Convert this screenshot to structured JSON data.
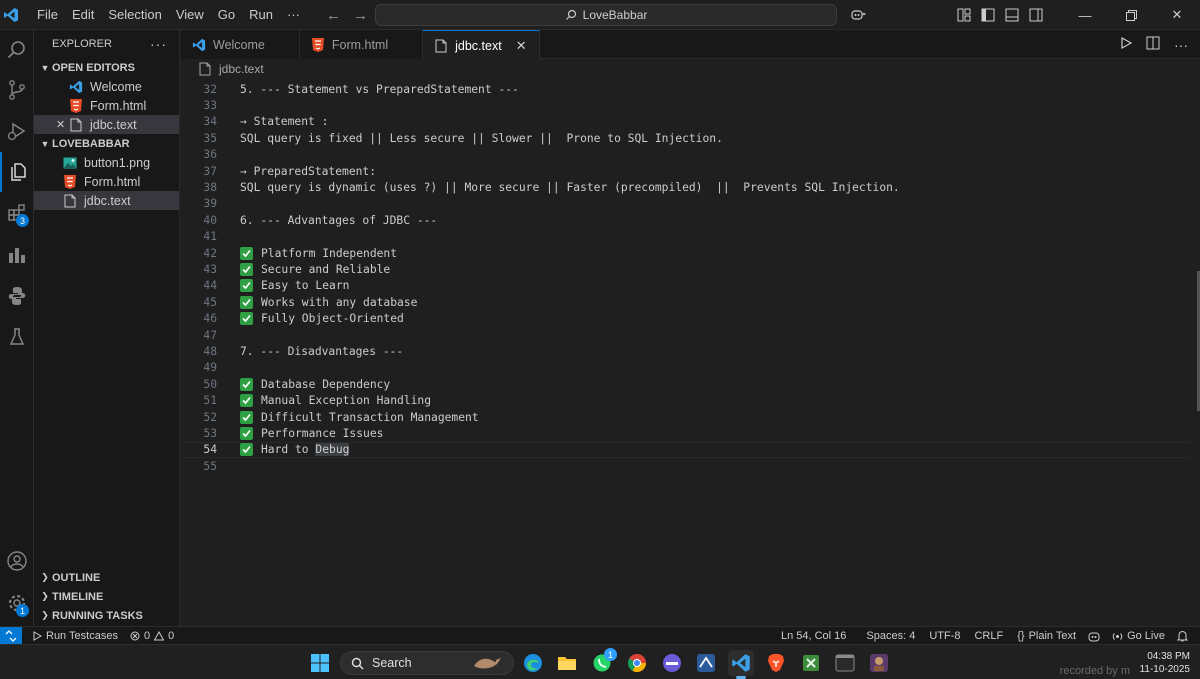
{
  "titlebar": {
    "menu": [
      "File",
      "Edit",
      "Selection",
      "View",
      "Go",
      "Run",
      "···"
    ],
    "search_text": "LoveBabbar"
  },
  "activity_bar": {
    "extensions_badge": "3",
    "settings_badge": "1"
  },
  "sidebar": {
    "title": "EXPLORER",
    "open_editors_label": "OPEN EDITORS",
    "open_editors": [
      {
        "name": "Welcome",
        "icon": "vscode-icon"
      },
      {
        "name": "Form.html",
        "icon": "html-icon"
      },
      {
        "name": "jdbc.text",
        "icon": "file-icon"
      }
    ],
    "folder_label": "LOVEBABBAR",
    "files": [
      {
        "name": "button1.png",
        "icon": "image-icon"
      },
      {
        "name": "Form.html",
        "icon": "html-icon"
      },
      {
        "name": "jdbc.text",
        "icon": "file-icon"
      }
    ],
    "outline_label": "OUTLINE",
    "timeline_label": "TIMELINE",
    "running_tasks_label": "RUNNING TASKS"
  },
  "tabs": [
    {
      "label": "Welcome",
      "icon": "vscode-icon"
    },
    {
      "label": "Form.html",
      "icon": "html-icon"
    },
    {
      "label": "jdbc.text",
      "icon": "file-icon"
    }
  ],
  "breadcrumb": "jdbc.text",
  "editor": {
    "lines": [
      {
        "n": "32",
        "text": "5. --- Statement vs PreparedStatement ---"
      },
      {
        "n": "33",
        "text": ""
      },
      {
        "n": "34",
        "text": "→ Statement :"
      },
      {
        "n": "35",
        "text": "SQL query is fixed || Less secure || Slower ||  Prone to SQL Injection."
      },
      {
        "n": "36",
        "text": ""
      },
      {
        "n": "37",
        "text": "→ PreparedStatement:"
      },
      {
        "n": "38",
        "text": "SQL query is dynamic (uses ?) || More secure || Faster (precompiled)  ||  Prevents SQL Injection."
      },
      {
        "n": "39",
        "text": ""
      },
      {
        "n": "40",
        "text": "6. --- Advantages of JDBC ---"
      },
      {
        "n": "41",
        "text": ""
      },
      {
        "n": "42",
        "text": "Platform Independent",
        "check": true
      },
      {
        "n": "43",
        "text": "Secure and Reliable",
        "check": true
      },
      {
        "n": "44",
        "text": "Easy to Learn",
        "check": true
      },
      {
        "n": "45",
        "text": "Works with any database",
        "check": true
      },
      {
        "n": "46",
        "text": "Fully Object-Oriented",
        "check": true
      },
      {
        "n": "47",
        "text": ""
      },
      {
        "n": "48",
        "text": "7. --- Disadvantages ---"
      },
      {
        "n": "49",
        "text": ""
      },
      {
        "n": "50",
        "text": "Database Dependency",
        "check": true
      },
      {
        "n": "51",
        "text": "Manual Exception Handling",
        "check": true
      },
      {
        "n": "52",
        "text": "Difficult Transaction Management",
        "check": true
      },
      {
        "n": "53",
        "text": "Performance Issues",
        "check": true
      },
      {
        "n": "54",
        "text": "Hard to ",
        "highlight": "Debug",
        "check": true,
        "current": true
      },
      {
        "n": "55",
        "text": ""
      }
    ]
  },
  "statusbar": {
    "run_testcases": "Run Testcases",
    "errors": "0",
    "warnings": "0",
    "position": "Ln 54, Col 16",
    "spaces": "Spaces: 4",
    "encoding": "UTF-8",
    "eol": "CRLF",
    "language": "Plain Text",
    "go_live": "Go Live"
  },
  "taskbar": {
    "search_label": "Search",
    "whatsapp_badge": "1",
    "time": "04:38 PM",
    "date": "11-10-2025",
    "watermark": "recorded by m"
  }
}
